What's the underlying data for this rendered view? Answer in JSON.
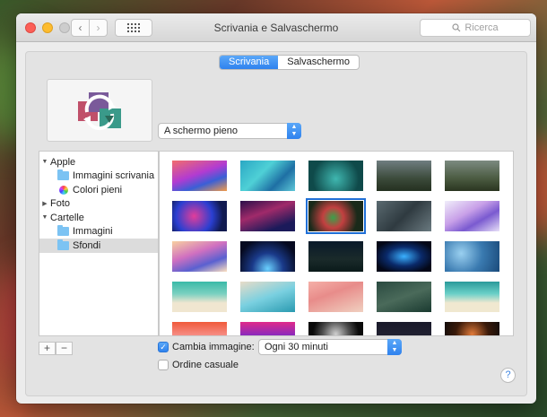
{
  "window": {
    "title": "Scrivania e Salvaschermo"
  },
  "toolbar": {
    "back_icon": "chevron-left-icon",
    "forward_icon": "chevron-right-icon",
    "grid_icon": "grid-icon",
    "search_placeholder": "Ricerca"
  },
  "tabs": [
    {
      "label": "Scrivania",
      "active": true
    },
    {
      "label": "Salvaschermo",
      "active": false
    }
  ],
  "display_mode": {
    "value": "A schermo pieno"
  },
  "sidebar": {
    "groups": [
      {
        "label": "Apple",
        "expanded": true,
        "items": [
          {
            "label": "Immagini scrivania",
            "icon": "folder-icon"
          },
          {
            "label": "Colori pieni",
            "icon": "color-wheel-icon"
          }
        ]
      },
      {
        "label": "Foto",
        "expanded": false,
        "items": []
      },
      {
        "label": "Cartelle",
        "expanded": true,
        "items": [
          {
            "label": "Immagini",
            "icon": "folder-icon"
          },
          {
            "label": "Sfondi",
            "icon": "folder-icon",
            "selected": true
          }
        ]
      }
    ]
  },
  "footer": {
    "add_label": "+",
    "remove_label": "−",
    "change_picture_label": "Cambia immagine:",
    "change_picture_checked": true,
    "interval_value": "Ogni 30 minuti",
    "random_order_label": "Ordine casuale",
    "random_order_checked": false,
    "help_label": "?"
  },
  "colors": {
    "accent": "#2f82ee",
    "selection": "#1f6fd6"
  },
  "thumbnails": [
    {
      "bg": "linear-gradient(160deg,#f26d6d,#b23bd1 45%,#3a5fd6 70%,#f29b4a)"
    },
    {
      "bg": "linear-gradient(135deg,#2aa7c4,#4fd0d6 40%,#1e6fa4 70%,#5ec8d8)"
    },
    {
      "bg": "radial-gradient(circle at 50% 60%,#3fb7b0,#0f4a4a 70%)"
    },
    {
      "bg": "linear-gradient(180deg,#6f7d80,#3b4a3a 60%,#243020)"
    },
    {
      "bg": "linear-gradient(180deg,#7b8a80,#4a5a40 60%,#2a3520)"
    },
    {
      "bg": "radial-gradient(circle at 40% 50%,#e23d9a,#2a3fd1 50%,#111a50 80%)"
    },
    {
      "bg": "linear-gradient(160deg,#2b0f4a,#a02a6a 40%,#1b1a5a 80%)"
    },
    {
      "bg": "radial-gradient(circle at 45% 55%,#3aa04a,#c24040 30%,#1a2a1a 70%)"
    },
    {
      "bg": "linear-gradient(135deg,#5a6a70,#2f3a40 50%,#6a7a80)"
    },
    {
      "bg": "linear-gradient(150deg,#f0eefa,#c8a0e8 40%,#7a5ad0 65%,#e8e0f8)"
    },
    {
      "bg": "linear-gradient(160deg,#f8d0a0,#d070c0 40%,#5a60d0 70%,#fde0c0)"
    },
    {
      "bg": "radial-gradient(ellipse at 50% 90%,#6ad0ff,#1a3a8a 40%,#060a20 80%)"
    },
    {
      "bg": "linear-gradient(180deg,#0a1a2a,#1a2a2a 60%,#0a1a1a)"
    },
    {
      "bg": "radial-gradient(ellipse at 50% 50%,#3ab0ff,#0a2a6a 45%,#040818 80%)"
    },
    {
      "bg": "radial-gradient(circle at 30% 40%,#9ad0f0,#3a7ab0 50%,#1a4a7a)"
    },
    {
      "bg": "linear-gradient(180deg,#3abaa8,#7ad0c0 40%,#f0e6d0 70%)"
    },
    {
      "bg": "linear-gradient(160deg,#e8dcc8,#7ad0e0 50%,#2a9ab0)"
    },
    {
      "bg": "linear-gradient(160deg,#f5b0a8,#e88c8a 40%,#f0d0c0)"
    },
    {
      "bg": "linear-gradient(160deg,#2a4a40,#4a6a5a 50%,#1a3a30)"
    },
    {
      "bg": "linear-gradient(180deg,#2a9a9a,#6ad0c8 40%,#f0e8d0 70%)"
    },
    {
      "bg": "linear-gradient(180deg,#f05a3a,#f8a0a0 60%,#fff)"
    },
    {
      "bg": "linear-gradient(180deg,#e02a8a,#6a2ad0 60%,#fff)"
    },
    {
      "bg": "radial-gradient(circle at 50% 40%,#d0d0d0,#505050 40%,#0a0a0a 70%)"
    },
    {
      "bg": "linear-gradient(180deg,#1a1a2a,#2a2a3a)"
    },
    {
      "bg": "radial-gradient(circle at 50% 40%,#e07a3a,#3a1a0a 50%,#0a0a0a)"
    }
  ]
}
